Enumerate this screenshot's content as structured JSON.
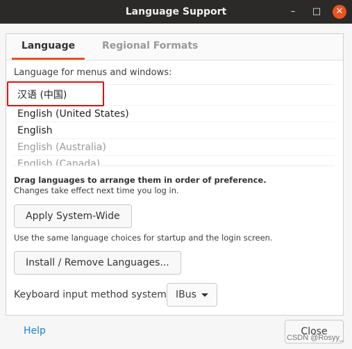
{
  "window": {
    "title": "Language Support",
    "minimize_icon": "minimize-icon",
    "maximize_icon": "maximize-icon",
    "close_icon": "close-icon"
  },
  "tabs": [
    {
      "label": "Language",
      "active": true
    },
    {
      "label": "Regional Formats",
      "active": false
    }
  ],
  "language": {
    "list_label": "Language for menus and windows:",
    "items": [
      {
        "label": "汉语 (中国)"
      },
      {
        "label": "English (United States)"
      },
      {
        "label": "English"
      },
      {
        "label": "English (Australia)"
      },
      {
        "label": "English (Canada)"
      }
    ],
    "drag_hint": "Drag languages to arrange them in order of preference.",
    "changes_note": "Changes take effect next time you log in.",
    "apply_button": "Apply System-Wide",
    "apply_note": "Use the same language choices for startup and the login screen.",
    "install_button": "Install / Remove Languages...",
    "input_method_label": "Keyboard input method system:",
    "input_method_value": "IBus"
  },
  "footer": {
    "help": "Help",
    "close": "Close"
  },
  "watermark": "CSDN @Rosyy_",
  "colors": {
    "accent": "#e9541f",
    "highlight_box": "#e01010",
    "link": "#1a83c4"
  }
}
